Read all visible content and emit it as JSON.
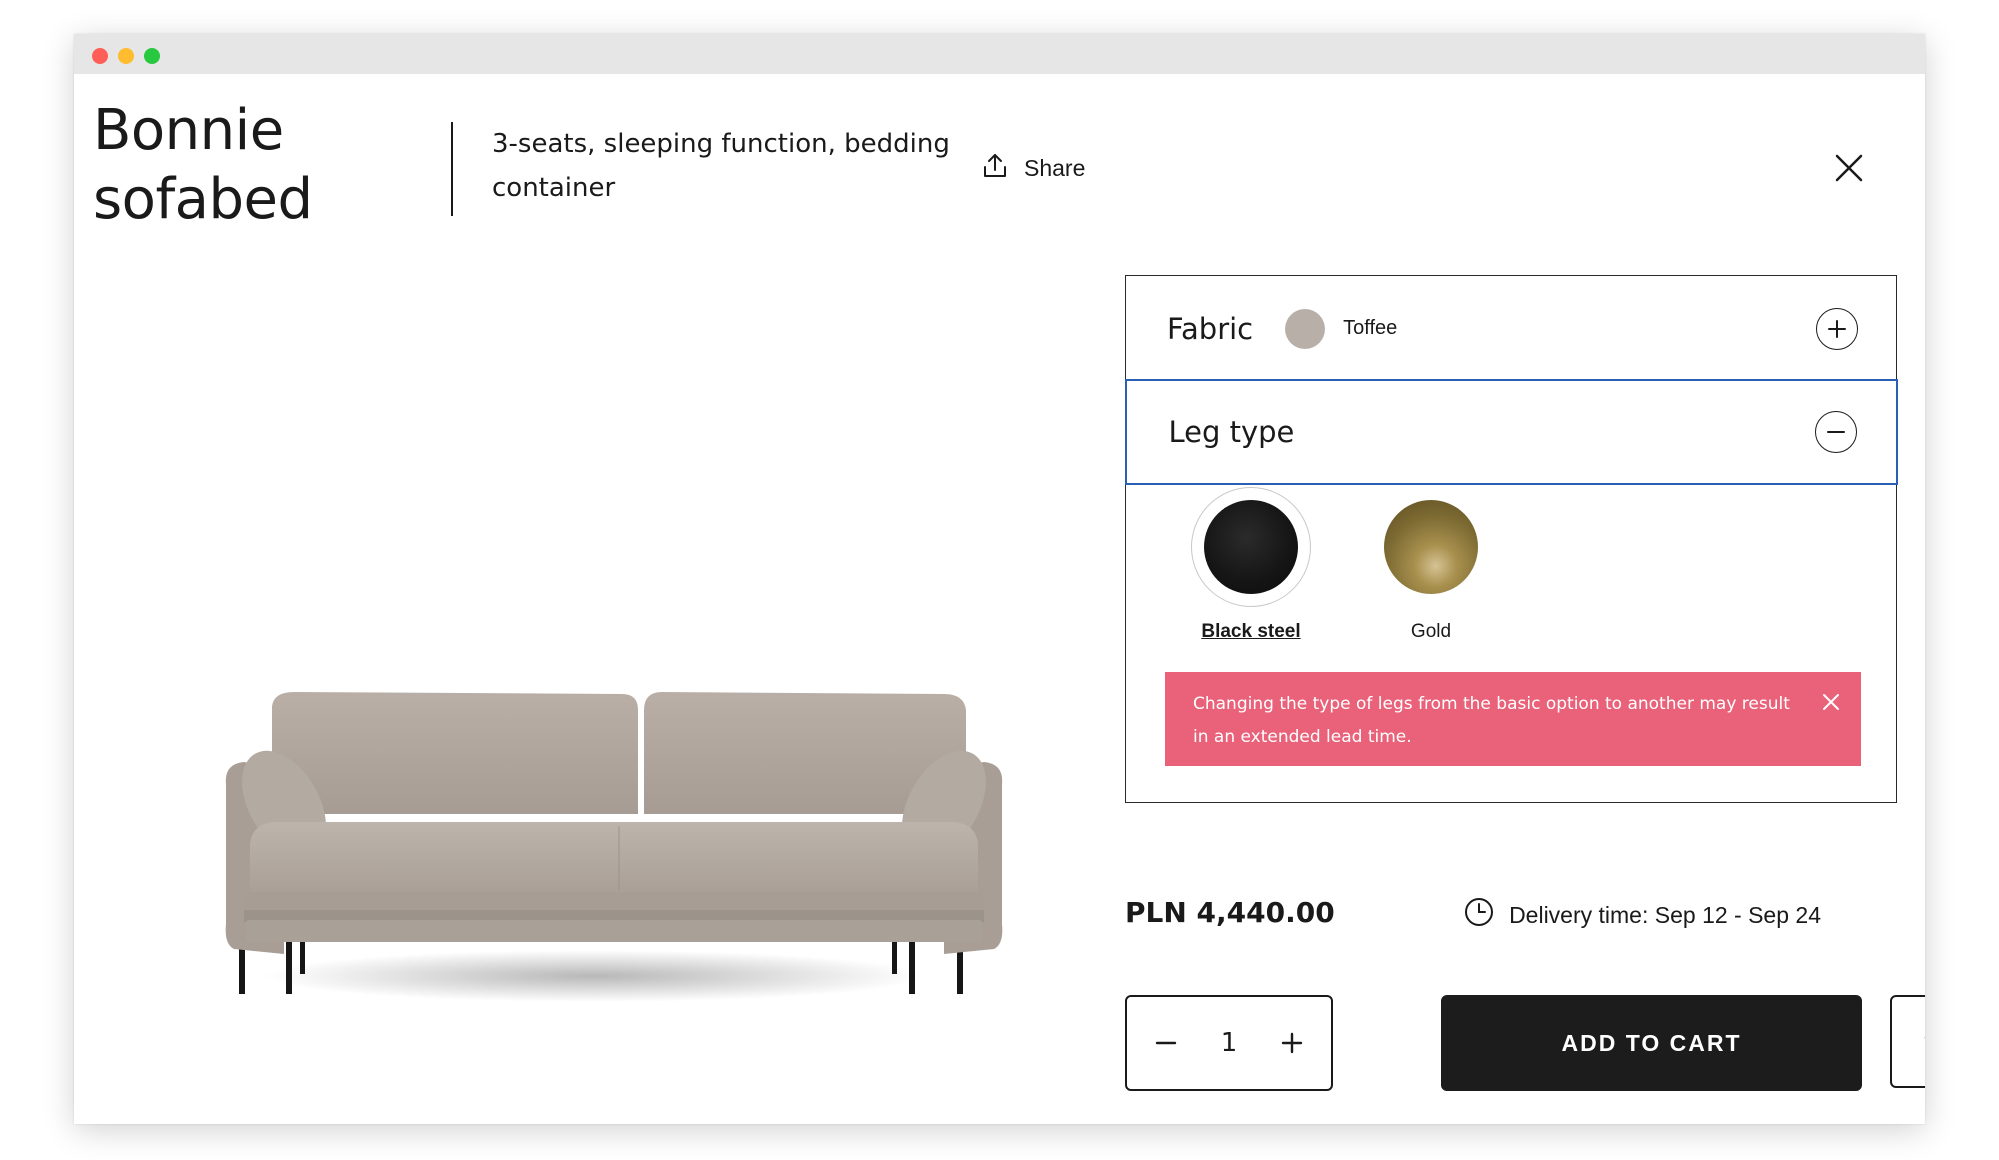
{
  "product": {
    "title": "Bonnie sofabed",
    "subtitle": "3-seats, sleeping function, bedding container"
  },
  "header": {
    "share_label": "Share",
    "share_icon": "share-upload-icon",
    "close_icon": "close-icon"
  },
  "config": {
    "fabric": {
      "label": "Fabric",
      "selected_value": "Toffee",
      "swatch_color": "#b8b0a8",
      "expand_icon": "plus-icon"
    },
    "leg_type": {
      "label": "Leg type",
      "collapse_icon": "minus-icon",
      "options": [
        {
          "label": "Black steel",
          "selected": true,
          "color": "#151515"
        },
        {
          "label": "Gold",
          "selected": false,
          "color": "#8a763c"
        }
      ]
    },
    "alert": {
      "text": "Changing the type of legs from the basic option to another may result in an extended lead time.",
      "color": "#e9627a"
    }
  },
  "purchase": {
    "price": "PLN 4,440.00",
    "delivery": "Delivery time: Sep 12 - Sep 24",
    "quantity": "1",
    "add_to_cart_label": "ADD TO CART",
    "wishlist_icon": "heart-icon"
  }
}
